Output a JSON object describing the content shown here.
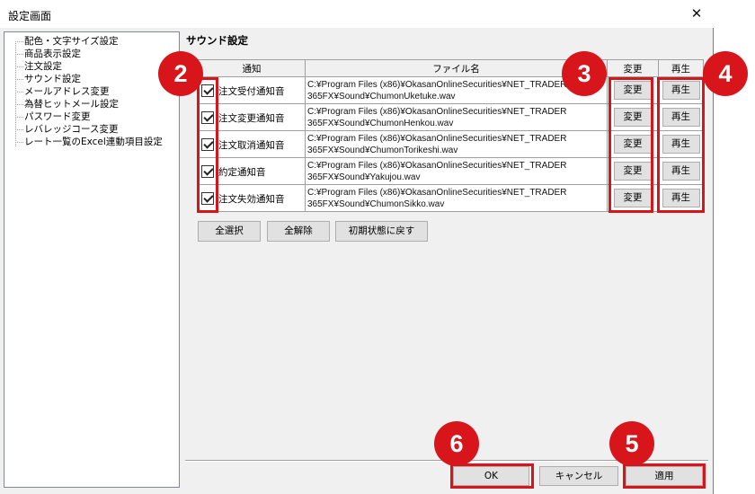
{
  "window": {
    "title": "設定画面",
    "close_symbol": "✕"
  },
  "tree": {
    "items": [
      "配色・文字サイズ設定",
      "商品表示設定",
      "注文設定",
      "サウンド設定",
      "メールアドレス変更",
      "為替ヒットメール設定",
      "パスワード変更",
      "レバレッジコース変更",
      "レート一覧のExcel連動項目設定"
    ],
    "selected": "サウンド設定"
  },
  "pane": {
    "title": "サウンド設定"
  },
  "table": {
    "headers": {
      "notice": "通知",
      "file": "ファイル名",
      "change": "変更",
      "play": "再生"
    },
    "rows": [
      {
        "checked": true,
        "label": "注文受付通知音",
        "path_line1": "C:¥Program Files (x86)¥OkasanOnlineSecurities¥NET_TRADER",
        "path_line2": "365FX¥Sound¥ChumonUketuke.wav",
        "change": "変更",
        "play": "再生"
      },
      {
        "checked": true,
        "label": "注文変更通知音",
        "path_line1": "C:¥Program Files (x86)¥OkasanOnlineSecurities¥NET_TRADER",
        "path_line2": "365FX¥Sound¥ChumonHenkou.wav",
        "change": "変更",
        "play": "再生"
      },
      {
        "checked": true,
        "label": "注文取消通知音",
        "path_line1": "C:¥Program Files (x86)¥OkasanOnlineSecurities¥NET_TRADER",
        "path_line2": "365FX¥Sound¥ChumonTorikeshi.wav",
        "change": "変更",
        "play": "再生"
      },
      {
        "checked": true,
        "label": "約定通知音",
        "path_line1": "C:¥Program Files (x86)¥OkasanOnlineSecurities¥NET_TRADER",
        "path_line2": "365FX¥Sound¥Yakujou.wav",
        "change": "変更",
        "play": "再生"
      },
      {
        "checked": true,
        "label": "注文失効通知音",
        "path_line1": "C:¥Program Files (x86)¥OkasanOnlineSecurities¥NET_TRADER",
        "path_line2": "365FX¥Sound¥ChumonSikko.wav",
        "change": "変更",
        "play": "再生"
      }
    ]
  },
  "actions": {
    "select_all": "全選択",
    "deselect_all": "全解除",
    "reset": "初期状態に戻す"
  },
  "footer": {
    "ok": "OK",
    "cancel": "キャンセル",
    "apply": "適用"
  },
  "annotations": {
    "badge2": "2",
    "badge3": "3",
    "badge4": "4",
    "badge5": "5",
    "badge6": "6",
    "color": "#d7151a"
  }
}
